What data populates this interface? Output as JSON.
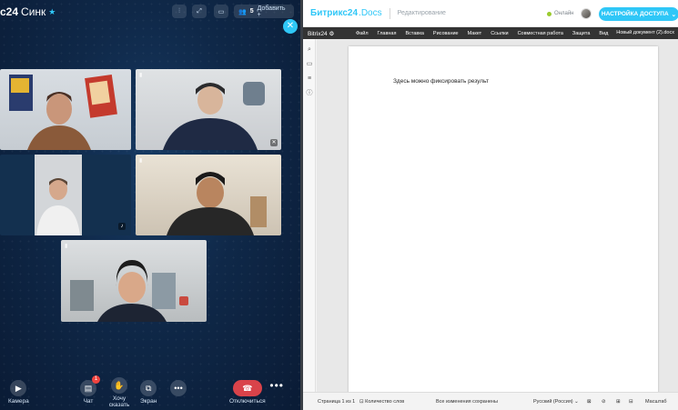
{
  "call": {
    "brand_logo": "c24",
    "brand_name": "Синк",
    "add_button_label": "Добавить +",
    "participants_count": "5",
    "tiles": [
      {
        "name": "participant-1"
      },
      {
        "name": "participant-2"
      },
      {
        "name": "participant-3"
      },
      {
        "name": "participant-4"
      },
      {
        "name": "participant-5"
      }
    ],
    "bottom": {
      "camera": "Камера",
      "chat": "Чат",
      "chat_badge": "1",
      "raise_hand": "Хочу сказать",
      "screen": "Экран",
      "hangup": "Отключиться"
    },
    "accent_color": "#2fc7f7",
    "hangup_color": "#d9434a"
  },
  "docs": {
    "logo_part1": "Битрикс24",
    "logo_part2": ".Docs",
    "mode": "Редактирование",
    "online": "Онлайн",
    "access_button": "НАСТРОЙКА ДОСТУПА",
    "toolbar_logo": "Bitrix24",
    "menu": [
      "Файл",
      "Главная",
      "Вставка",
      "Рисование",
      "Макет",
      "Ссылки",
      "Совместная работа",
      "Защита",
      "Вид"
    ],
    "doc_name": "Новый документ (2).docx",
    "page_text": "Здесь можно фиксировать результ",
    "status": {
      "page": "Страница 1 из 1",
      "words": "Количество слов",
      "saved": "Все изменения сохранены",
      "language": "Русский (Россия)",
      "zoom": "Масштаб"
    }
  }
}
